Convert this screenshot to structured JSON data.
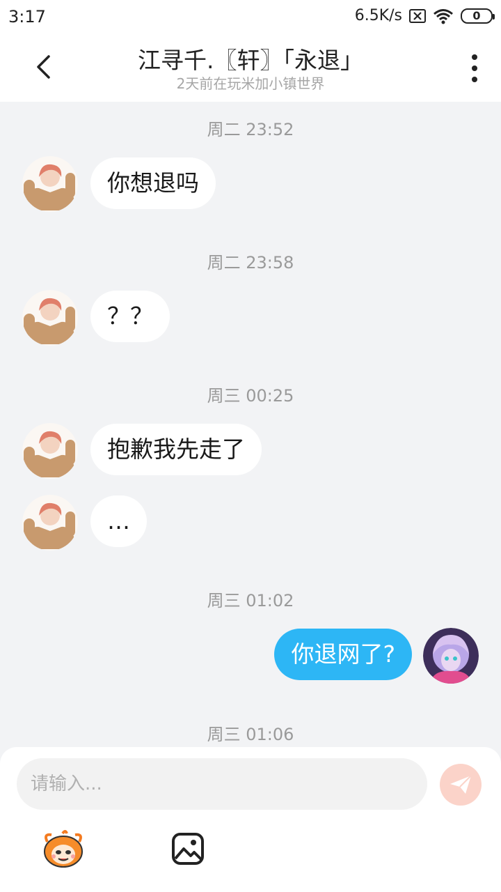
{
  "status_bar": {
    "time": "3:17",
    "network_speed": "6.5K/s",
    "battery": "0"
  },
  "header": {
    "title": "江寻千.〖轩〗「永退」",
    "subtitle": "2天前在玩米加小镇世界",
    "back_icon": "chevron-left-icon",
    "more_icon": "more-vertical-icon"
  },
  "messages": [
    {
      "timestamp": "周二 23:52"
    },
    {
      "sender": "other",
      "text": "你想退吗"
    },
    {
      "timestamp": "周二 23:58"
    },
    {
      "sender": "other",
      "text": "？？"
    },
    {
      "timestamp": "周三 00:25"
    },
    {
      "sender": "other",
      "text": "抱歉我先走了"
    },
    {
      "sender": "other",
      "text": "…"
    },
    {
      "timestamp": "周三 01:02"
    },
    {
      "sender": "me",
      "text": "你退网了?"
    },
    {
      "timestamp": "周三 01:06"
    }
  ],
  "composer": {
    "placeholder": "请输入...",
    "send_icon": "send-icon",
    "emoji_icon": "mascot-emoji-icon",
    "image_icon": "image-icon"
  },
  "colors": {
    "my_bubble": "#2db6f5",
    "their_bubble": "#ffffff",
    "chat_background": "#f2f3f5",
    "send_button_disabled": "#fbd3c9"
  }
}
